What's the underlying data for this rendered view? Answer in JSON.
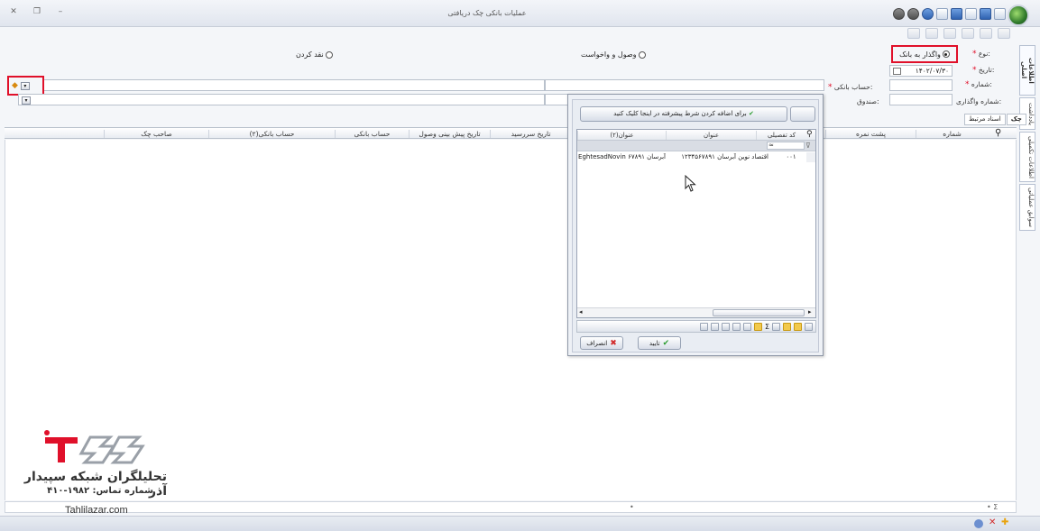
{
  "window": {
    "title": "عملیات بانکی چک دریافتی",
    "close_glyph": "✕",
    "restore_glyph": "❐",
    "min_glyph": "–"
  },
  "form": {
    "type_label": "نوع:",
    "radios": [
      {
        "label": "واگذار به بانک",
        "checked": true
      },
      {
        "label": "وصول و واخواست",
        "checked": false
      },
      {
        "label": "نقد کردن",
        "checked": false
      }
    ],
    "date_label": "تاریخ:",
    "date_value": "۱۴۰۲/۰۷/۳۰",
    "number_label": "شماره:",
    "number_value": "",
    "bank_account_label": "حساب بانکی:",
    "assign_number_label": "شماره واگذاری:",
    "fund_label": "صندوق:",
    "required_mark": "*"
  },
  "vertical_tabs": [
    "اطلاعات اصلی",
    "یادداشت",
    "اطلاعات تکمیلی",
    "سوابق عملیاتی"
  ],
  "grid": {
    "tabs": [
      "چک",
      "اسناد مرتبط"
    ],
    "columns": [
      "شماره",
      "پشت نمره",
      "تاریخ سررسید",
      "تاریخ پیش بینی وصول",
      "حساب بانکی",
      "حساب بانکی(۲)",
      "صاحب چک"
    ]
  },
  "popup": {
    "advanced_condition_label": "برای اضافه کردن شرط پیشرفته در اینجا کلیک کنید",
    "columns": [
      "کد تفصیلی",
      "عنوان",
      "عنوان(۲)"
    ],
    "rows": [
      {
        "code": "۰۰۱",
        "title": "اقتصاد نوین آبرسان ۱۲۳۴۵۶۷۸۹۱",
        "title2": "EghtesadNovin آبرسان ۶۷۸۹۱"
      }
    ],
    "ok_label": "تایید",
    "cancel_label": "انصراف",
    "sigma_glyph": "Σ"
  },
  "footer": {
    "sigma_glyph": "Σ",
    "dot": "•"
  },
  "watermark": {
    "name": "تحلیلگران شبکه سپیدار آذر",
    "tel": "شماره تماس: ۱۹۸۲-۴۱۰",
    "site": "Tahlilazar.com"
  }
}
